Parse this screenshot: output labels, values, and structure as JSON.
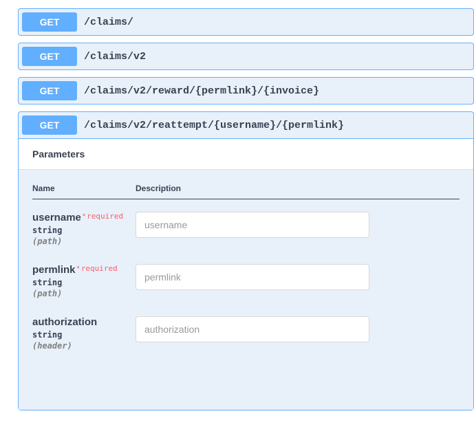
{
  "method_label": "GET",
  "endpoints": [
    {
      "path": "/claims/"
    },
    {
      "path": "/claims/v2"
    },
    {
      "path": "/claims/v2/reward/{permlink}/{invoice}"
    },
    {
      "path": "/claims/v2/reattempt/{username}/{permlink}"
    }
  ],
  "parameters_section_title": "Parameters",
  "table_headers": {
    "name": "Name",
    "description": "Description"
  },
  "required_label": "required",
  "params": [
    {
      "name": "username",
      "type": "string",
      "in": "(path)",
      "required": true,
      "placeholder": "username"
    },
    {
      "name": "permlink",
      "type": "string",
      "in": "(path)",
      "required": true,
      "placeholder": "permlink"
    },
    {
      "name": "authorization",
      "type": "string",
      "in": "(header)",
      "required": false,
      "placeholder": "authorization"
    }
  ]
}
